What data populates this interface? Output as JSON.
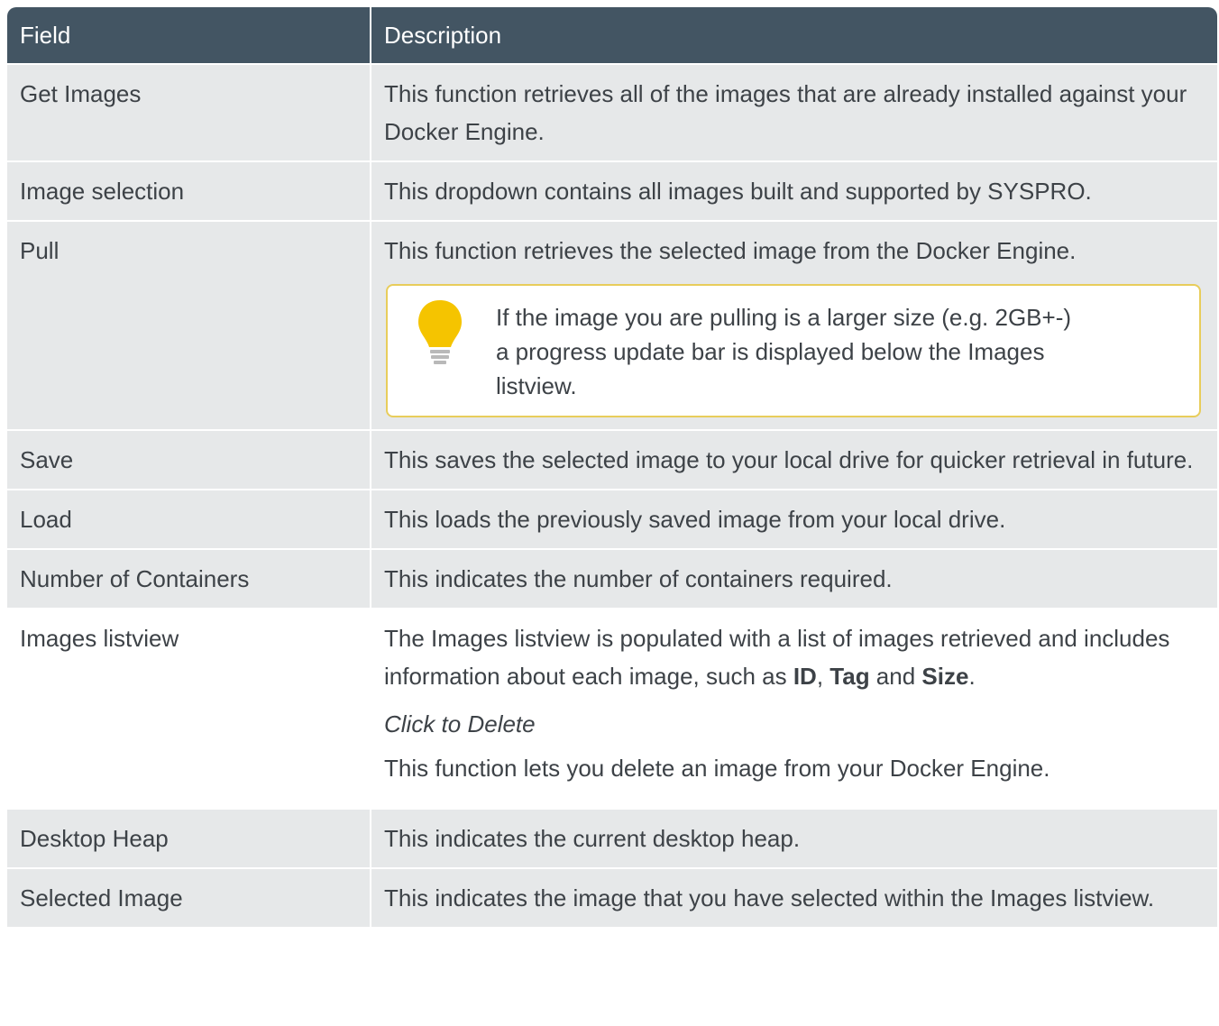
{
  "table": {
    "headers": [
      "Field",
      "Description"
    ],
    "rows": [
      {
        "field": "Get Images",
        "description": "This function retrieves all of the images that are already installed against your Docker Engine."
      },
      {
        "field": "Image selection",
        "description": "This dropdown contains all images built and supported by SYSPRO."
      },
      {
        "field": "Pull",
        "description": "This function retrieves the selected image from the Docker Engine.",
        "note": "If the image you are pulling is a larger size (e.g. 2GB+-) a progress update bar is displayed below the Images listview."
      },
      {
        "field": "Save",
        "description": "This saves the selected image to your local drive for quicker retrieval in future."
      },
      {
        "field": "Load",
        "description": "This loads the previously saved image from your local drive."
      },
      {
        "field": "Number of Containers",
        "description": "This indicates the number of containers required."
      },
      {
        "field": "Images listview",
        "description_parts": {
          "lead": "The Images listview is populated with a list of images retrieved and includes information about each image, such as ",
          "b1": "ID",
          "sep1": ", ",
          "b2": "Tag",
          "sep2": " and ",
          "b3": "Size",
          "end": "."
        },
        "sub_heading": "Click to Delete",
        "sub_description": "This function lets you delete an image from your Docker Engine."
      },
      {
        "field": "Desktop Heap",
        "description": "This indicates the current desktop heap."
      },
      {
        "field": "Selected Image",
        "description": "This indicates the image that you have selected within the Images listview."
      }
    ]
  },
  "icons": {
    "note_icon": "lightbulb-icon",
    "note_border_color": "#e8cd5b",
    "bulb_color": "#f5c400",
    "header_color": "#435563",
    "row_shade_color": "#e6e8e9"
  }
}
